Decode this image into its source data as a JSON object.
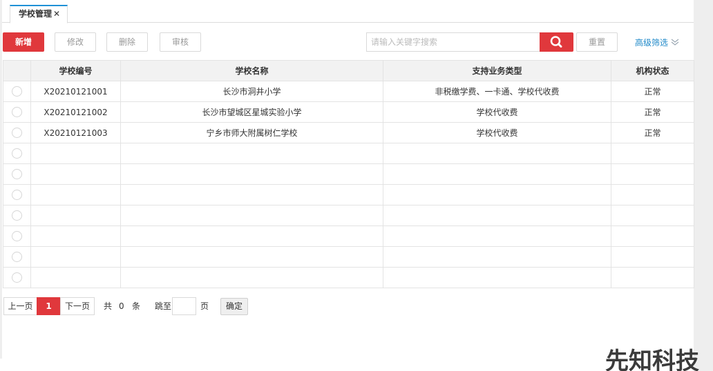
{
  "tab": {
    "label": "学校管理",
    "close": "✕"
  },
  "toolbar": {
    "add": "新增",
    "edit": "修改",
    "delete": "删除",
    "audit": "审核",
    "search_placeholder": "请输入关键字搜索",
    "search_icon": "search-icon",
    "reset": "重置",
    "advanced_filter": "高级筛选",
    "accent_color": "#e0383c",
    "link_color": "#1e88c8"
  },
  "table": {
    "columns": [
      "学校编号",
      "学校名称",
      "支持业务类型",
      "机构状态"
    ],
    "rows": [
      [
        "X20210121001",
        "长沙市洞井小学",
        "非税缴学费、一卡通、学校代收费",
        "正常"
      ],
      [
        "X20210121002",
        "长沙市望城区星城实验小学",
        "学校代收费",
        "正常"
      ],
      [
        "X20210121003",
        "宁乡市师大附属树仁学校",
        "学校代收费",
        "正常"
      ]
    ]
  },
  "pagination": {
    "prev": "上一页",
    "current": "1",
    "next": "下一页",
    "total_prefix": "共",
    "total": "0",
    "total_suffix": "条",
    "jump_prefix": "跳至",
    "jump_suffix": "页",
    "confirm": "确定"
  },
  "watermark": "先知科技"
}
